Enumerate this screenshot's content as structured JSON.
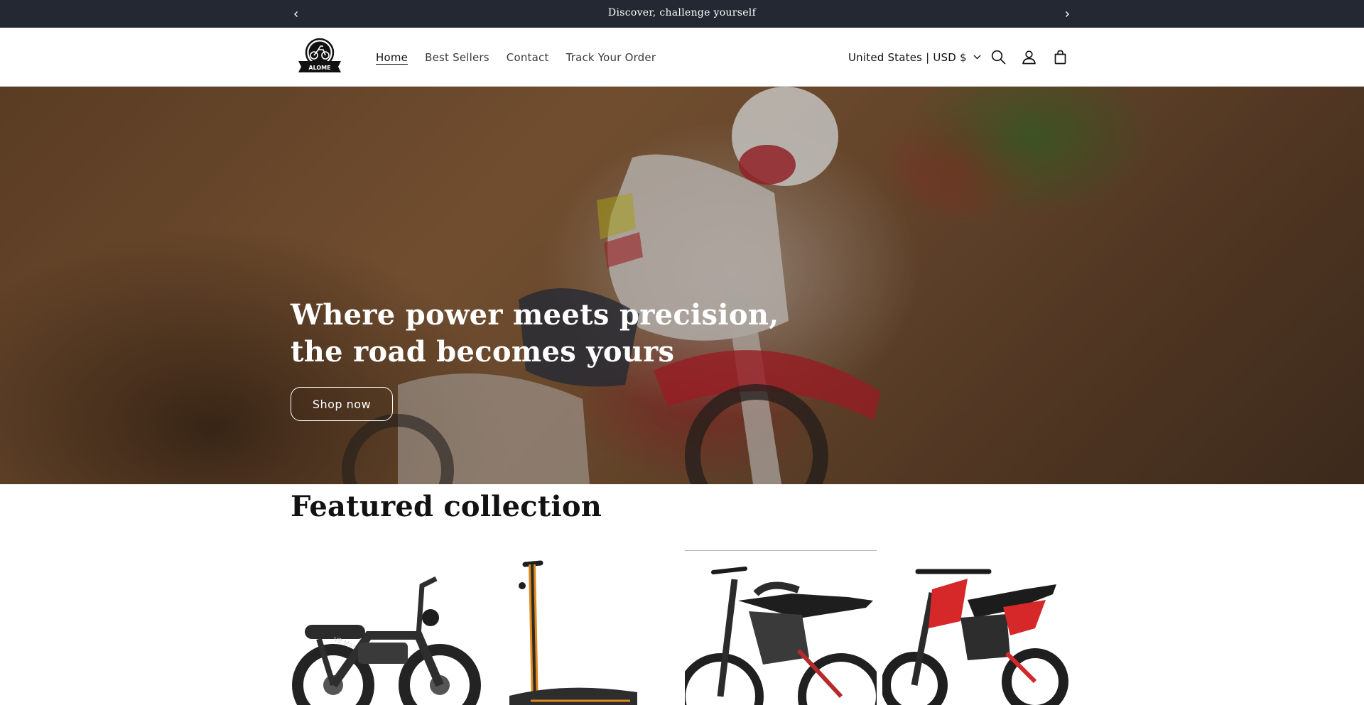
{
  "announcement": {
    "message": "Discover, challenge yourself",
    "prev_icon": "chevron-left-icon",
    "next_icon": "chevron-right-icon"
  },
  "header": {
    "logo_text": "ALOME",
    "nav": [
      {
        "label": "Home",
        "active": true
      },
      {
        "label": "Best Sellers",
        "active": false
      },
      {
        "label": "Contact",
        "active": false
      },
      {
        "label": "Track Your Order",
        "active": false
      }
    ],
    "locale": "United States | USD $",
    "icons": [
      "search-icon",
      "account-icon",
      "cart-icon"
    ]
  },
  "hero": {
    "heading": "Where power meets precision, the road becomes yours",
    "button": "Shop now"
  },
  "featured": {
    "title": "Featured collection",
    "products": [
      {
        "image": "electric-fat-bike-image",
        "frame_text": "V8 Max"
      },
      {
        "image": "electric-scooter-image"
      },
      {
        "image": "electric-dirt-bike-black-image"
      },
      {
        "image": "kids-electric-dirt-bike-red-image"
      }
    ]
  },
  "colors": {
    "announcement_bg": "#242833",
    "text": "#121212",
    "hero_button_border": "#ffffff"
  }
}
